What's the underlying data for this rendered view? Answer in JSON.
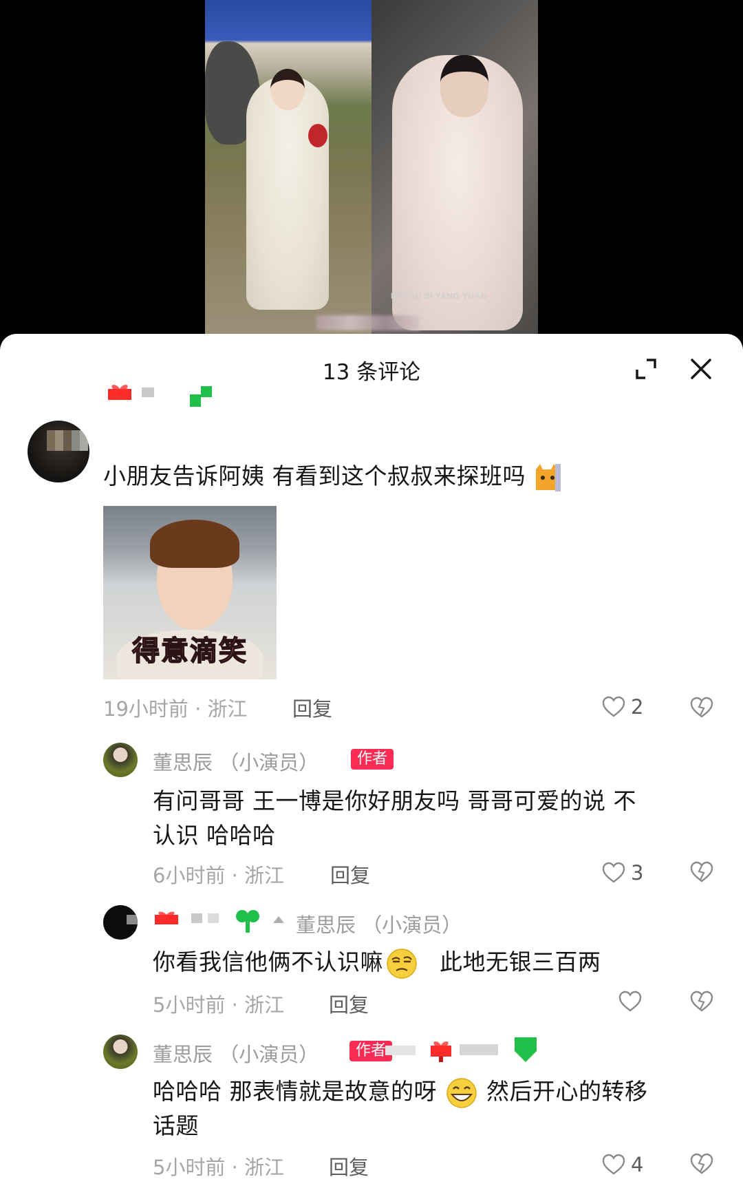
{
  "video": {
    "watermark": "HIM SU SI YANG YUAN"
  },
  "sheet": {
    "title": "13 条评论"
  },
  "comments": [
    {
      "text": "小朋友告诉阿姨  有看到这个叔叔来探班吗",
      "sticker_caption": "得意滴笑",
      "meta": "19小时前 · 浙江",
      "reply_label": "回复",
      "likes": "2"
    },
    {
      "author": "董思辰 （小演员）",
      "badge": "作者",
      "text_line1": "有问哥哥 王一博是你好朋友吗 哥哥可爱的说 不",
      "text_line2": "认识 哈哈哈",
      "meta": "6小时前 · 浙江",
      "reply_label": "回复",
      "likes": "3"
    },
    {
      "reply_to": "董思辰 （小演员）",
      "text_part1": "你看我信他俩不认识嘛",
      "text_part2": "此地无银三百两",
      "meta": "5小时前 · 浙江",
      "reply_label": "回复",
      "likes": ""
    },
    {
      "author": "董思辰 （小演员）",
      "badge": "作者",
      "text_part1": "哈哈哈 那表情就是故意的呀",
      "text_part2": "然后开心的转移",
      "text_line2": "话题",
      "meta": "5小时前 · 浙江",
      "reply_label": "回复",
      "likes": "4"
    }
  ]
}
